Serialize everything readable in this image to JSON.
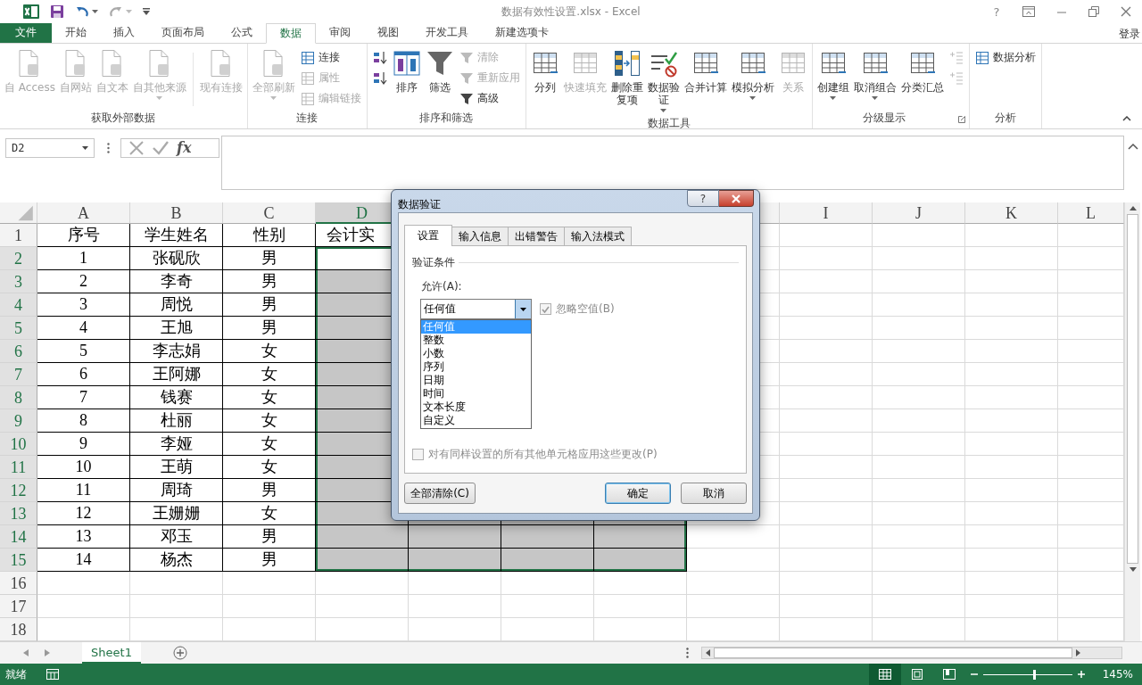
{
  "window": {
    "title": "数据有效性设置.xlsx - Excel",
    "help": "?"
  },
  "ribbon": {
    "tabs": [
      {
        "label": "文件",
        "kind": "file",
        "selected": false
      },
      {
        "label": "开始",
        "kind": "tab",
        "selected": false
      },
      {
        "label": "插入",
        "kind": "tab",
        "selected": false
      },
      {
        "label": "页面布局",
        "kind": "tab",
        "selected": false
      },
      {
        "label": "公式",
        "kind": "tab",
        "selected": false
      },
      {
        "label": "数据",
        "kind": "tab",
        "selected": true
      },
      {
        "label": "审阅",
        "kind": "tab",
        "selected": false
      },
      {
        "label": "视图",
        "kind": "tab",
        "selected": false
      },
      {
        "label": "开发工具",
        "kind": "tab",
        "selected": false
      },
      {
        "label": "新建选项卡",
        "kind": "tab",
        "selected": false
      }
    ],
    "account": "登录",
    "groups": [
      {
        "label": "获取外部数据",
        "launcher": false,
        "items": [
          {
            "kind": "large",
            "label": "自 Access",
            "disabled": true,
            "dropdown": false
          },
          {
            "kind": "large",
            "label": "自网站",
            "disabled": true,
            "dropdown": false
          },
          {
            "kind": "large",
            "label": "自文本",
            "disabled": true,
            "dropdown": false
          },
          {
            "kind": "large",
            "label": "自其他来源",
            "disabled": true,
            "dropdown": true
          },
          {
            "kind": "separator"
          },
          {
            "kind": "large",
            "label": "现有连接",
            "disabled": true,
            "dropdown": false
          }
        ]
      },
      {
        "label": "连接",
        "launcher": false,
        "items": [
          {
            "kind": "large",
            "label": "全部刷新",
            "disabled": true,
            "dropdown": true
          },
          {
            "kind": "small",
            "label": "连接",
            "disabled": false
          },
          {
            "kind": "small",
            "label": "属性",
            "disabled": true
          },
          {
            "kind": "small",
            "label": "编辑链接",
            "disabled": true
          }
        ]
      },
      {
        "label": "排序和筛选",
        "launcher": false,
        "items": [
          {
            "kind": "small",
            "disabled": false
          },
          {
            "kind": "small",
            "disabled": false
          },
          {
            "kind": "large",
            "label": "排序",
            "disabled": false,
            "dropdown": false
          },
          {
            "kind": "large",
            "label": "筛选",
            "disabled": false,
            "dropdown": false
          },
          {
            "kind": "small",
            "label": "清除",
            "disabled": true
          },
          {
            "kind": "small",
            "label": "重新应用",
            "disabled": true
          },
          {
            "kind": "small",
            "label": "高级",
            "disabled": false
          }
        ]
      },
      {
        "label": "数据工具",
        "launcher": false,
        "items": [
          {
            "kind": "large",
            "label": "分列",
            "disabled": false,
            "dropdown": false
          },
          {
            "kind": "large",
            "label": "快速填充",
            "disabled": true,
            "dropdown": false
          },
          {
            "kind": "large",
            "label": "删除重复项",
            "disabled": false,
            "dropdown": false,
            "wrap": true
          },
          {
            "kind": "large",
            "label": "数据验证",
            "disabled": false,
            "dropdown": true,
            "wrap": true
          },
          {
            "kind": "large",
            "label": "合并计算",
            "disabled": false,
            "dropdown": false
          },
          {
            "kind": "large",
            "label": "模拟分析",
            "disabled": false,
            "dropdown": true
          },
          {
            "kind": "large",
            "label": "关系",
            "disabled": true,
            "dropdown": false
          }
        ]
      },
      {
        "label": "分级显示",
        "launcher": true,
        "items": [
          {
            "kind": "large",
            "label": "创建组",
            "disabled": false,
            "dropdown": true
          },
          {
            "kind": "large",
            "label": "取消组合",
            "disabled": false,
            "dropdown": true
          },
          {
            "kind": "large",
            "label": "分类汇总",
            "disabled": false,
            "dropdown": false
          },
          {
            "kind": "small",
            "disabled": true
          },
          {
            "kind": "small",
            "disabled": true
          }
        ]
      },
      {
        "label": "分析",
        "launcher": false,
        "items": [
          {
            "kind": "small",
            "label": "数据分析",
            "disabled": false
          }
        ]
      }
    ]
  },
  "formula_bar": {
    "name_box": "D2",
    "function_label": "fx"
  },
  "sheet": {
    "column_headers": [
      {
        "label": "A",
        "selected": false
      },
      {
        "label": "B",
        "selected": false
      },
      {
        "label": "C",
        "selected": false
      },
      {
        "label": "D",
        "selected": true
      }
    ],
    "column_headers_right": [
      {
        "label": "I",
        "selected": false
      },
      {
        "label": "J",
        "selected": false
      },
      {
        "label": "K",
        "selected": false
      },
      {
        "label": "L",
        "selected": false
      }
    ],
    "rows": [
      {
        "number": "1",
        "selected": false,
        "active": false,
        "bordered": true,
        "cells": [
          "序号",
          "学生姓名",
          "性别",
          "会计实"
        ]
      },
      {
        "number": "2",
        "selected": true,
        "active": true,
        "bordered": true,
        "cells": [
          "1",
          "张砚欣",
          "男"
        ]
      },
      {
        "number": "3",
        "selected": true,
        "active": false,
        "bordered": true,
        "cells": [
          "2",
          "李奇",
          "男"
        ]
      },
      {
        "number": "4",
        "selected": true,
        "active": false,
        "bordered": true,
        "cells": [
          "3",
          "周悦",
          "男"
        ]
      },
      {
        "number": "5",
        "selected": true,
        "active": false,
        "bordered": true,
        "cells": [
          "4",
          "王旭",
          "男"
        ]
      },
      {
        "number": "6",
        "selected": true,
        "active": false,
        "bordered": true,
        "cells": [
          "5",
          "李志娟",
          "女"
        ]
      },
      {
        "number": "7",
        "selected": true,
        "active": false,
        "bordered": true,
        "cells": [
          "6",
          "王阿娜",
          "女"
        ]
      },
      {
        "number": "8",
        "selected": true,
        "active": false,
        "bordered": true,
        "cells": [
          "7",
          "钱赛",
          "女"
        ]
      },
      {
        "number": "9",
        "selected": true,
        "active": false,
        "bordered": true,
        "cells": [
          "8",
          "杜丽",
          "女"
        ]
      },
      {
        "number": "10",
        "selected": true,
        "active": false,
        "bordered": true,
        "cells": [
          "9",
          "李娅",
          "女"
        ]
      },
      {
        "number": "11",
        "selected": true,
        "active": false,
        "bordered": true,
        "cells": [
          "10",
          "王萌",
          "女"
        ]
      },
      {
        "number": "12",
        "selected": true,
        "active": false,
        "bordered": true,
        "cells": [
          "11",
          "周琦",
          "男"
        ]
      },
      {
        "number": "13",
        "selected": true,
        "active": false,
        "bordered": true,
        "cells": [
          "12",
          "王姗姗",
          "女"
        ]
      },
      {
        "number": "14",
        "selected": true,
        "active": false,
        "bordered": true,
        "cells": [
          "13",
          "邓玉",
          "男"
        ]
      },
      {
        "number": "15",
        "selected": true,
        "active": false,
        "bordered": true,
        "cells": [
          "14",
          "杨杰",
          "男"
        ]
      },
      {
        "number": "16",
        "selected": false,
        "active": false,
        "bordered": false,
        "cells": []
      },
      {
        "number": "17",
        "selected": false,
        "active": false,
        "bordered": false,
        "cells": []
      },
      {
        "number": "18",
        "selected": false,
        "active": false,
        "bordered": false,
        "cells": []
      }
    ]
  },
  "sheet_tabs": [
    {
      "label": "Sheet1",
      "selected": true
    }
  ],
  "status_bar": {
    "status": "就绪",
    "views": [
      {
        "selected": true
      },
      {
        "selected": false
      },
      {
        "selected": false
      }
    ],
    "zoom": {
      "level": 0.57
    },
    "zoom_label": "145%"
  },
  "dialog": {
    "title": "数据验证",
    "help": "?",
    "tabs": [
      {
        "label": "设置",
        "selected": true
      },
      {
        "label": "输入信息",
        "selected": false
      },
      {
        "label": "出错警告",
        "selected": false
      },
      {
        "label": "输入法模式",
        "selected": false
      }
    ],
    "section": "验证条件",
    "allow_label": "允许(A):",
    "allow": {
      "value": "任何值",
      "expanded": true,
      "options": [
        {
          "label": "任何值",
          "selected": true
        },
        {
          "label": "整数",
          "selected": false
        },
        {
          "label": "小数",
          "selected": false
        },
        {
          "label": "序列",
          "selected": false
        },
        {
          "label": "日期",
          "selected": false
        },
        {
          "label": "时间",
          "selected": false
        },
        {
          "label": "文本长度",
          "selected": false
        },
        {
          "label": "自定义",
          "selected": false
        }
      ]
    },
    "ignore_blank": {
      "label": "忽略空值(B)",
      "checked": true,
      "disabled": true
    },
    "apply_all": {
      "label": "对有同样设置的所有其他单元格应用这些更改(P)",
      "checked": false,
      "disabled": true
    },
    "buttons": [
      {
        "label": "全部清除(C)",
        "default": false
      },
      {
        "label": "确定",
        "default": true
      },
      {
        "label": "取消",
        "default": false
      }
    ]
  }
}
